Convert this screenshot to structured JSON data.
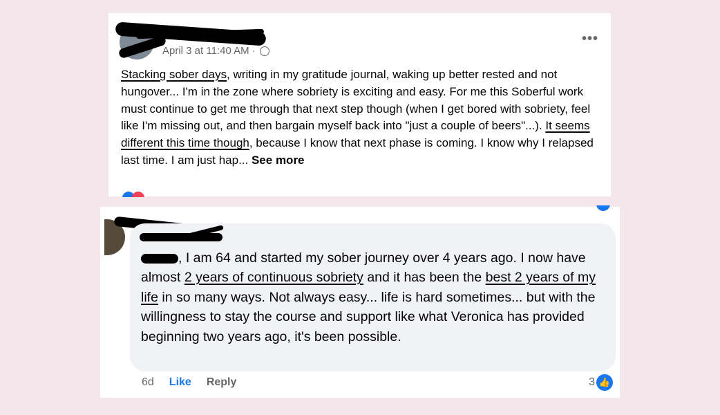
{
  "post": {
    "timestamp": "April 3 at 11:40 AM · ",
    "more_label": "•••",
    "text_parts": [
      "Stacking sober days",
      ", writing in my gratitude journal, waking up better rested and not hungover... I'm in the zone where sobriety is exciting and easy. For me this Soberful work must continue to get me through that next step though (when I get bored with sobriety, feel like I'm missing out, and then bargain myself back into \"just a couple of beers\"...). ",
      "It seems different this time though",
      ", because I know that next phase is coming. I know why I relapsed last time. I am just hap... "
    ],
    "see_more": "See more"
  },
  "comment": {
    "text_parts": [
      ", I am 64 and started my sober journey over 4 years ago. I now have almost ",
      "2 years of continuous sobriety",
      " and it has been the ",
      "best 2 years of my life",
      " in so many ways. Not always easy... life is hard sometimes... but with the willingness to stay the course and support like what Veronica has provided beginning two years ago, it's been possible."
    ],
    "time": "6d",
    "like_label": "Like",
    "reply_label": "Reply",
    "like_count": "3",
    "thumb_icon": "👍"
  },
  "colors": {
    "background": "#f3e7ec",
    "facebook_blue": "#1877f2",
    "bubble": "#f0f2f5",
    "muted_text": "#65676b"
  }
}
